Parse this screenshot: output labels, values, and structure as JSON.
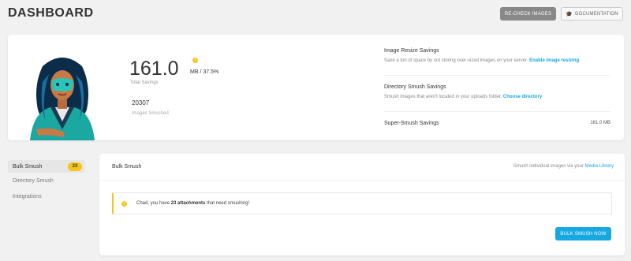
{
  "header": {
    "title": "DASHBOARD",
    "recheck_label": "RE-CHECK IMAGES",
    "docs_label": "DOCUMENTATION",
    "docs_icon": "mortarboard-icon"
  },
  "summary": {
    "savings_value": "161.0",
    "savings_unit": "MB / 37.5%",
    "savings_label": "Total Savings",
    "smushed_count": "20307",
    "smushed_label": "Images Smushed",
    "resize": {
      "title": "Image Resize Savings",
      "desc": "Save a ton of space by not storing over-sized images on your server.",
      "link": "Enable image resizing"
    },
    "directory": {
      "title": "Directory Smush Savings",
      "desc": "Smush images that aren't located in your uploads folder.",
      "link": "Choose directory"
    },
    "supersmush": {
      "title": "Super-Smush Savings",
      "value": "161.0 MB"
    }
  },
  "sidebar": {
    "items": [
      {
        "label": "Bulk Smush",
        "badge": "23"
      },
      {
        "label": "Directory Smush"
      },
      {
        "label": "Integrations"
      }
    ]
  },
  "bulk": {
    "title": "Bulk Smush",
    "hint_prefix": "Smush individual images via your",
    "hint_link": "Media Library",
    "notice_prefix": "Chad, you have",
    "notice_bold": "23 attachments",
    "notice_suffix": "that need smushing!",
    "button_label": "BULK SMUSH NOW"
  },
  "colors": {
    "accent": "#17a8e3",
    "warning": "#f5c518",
    "recheck_bg": "#888888"
  }
}
